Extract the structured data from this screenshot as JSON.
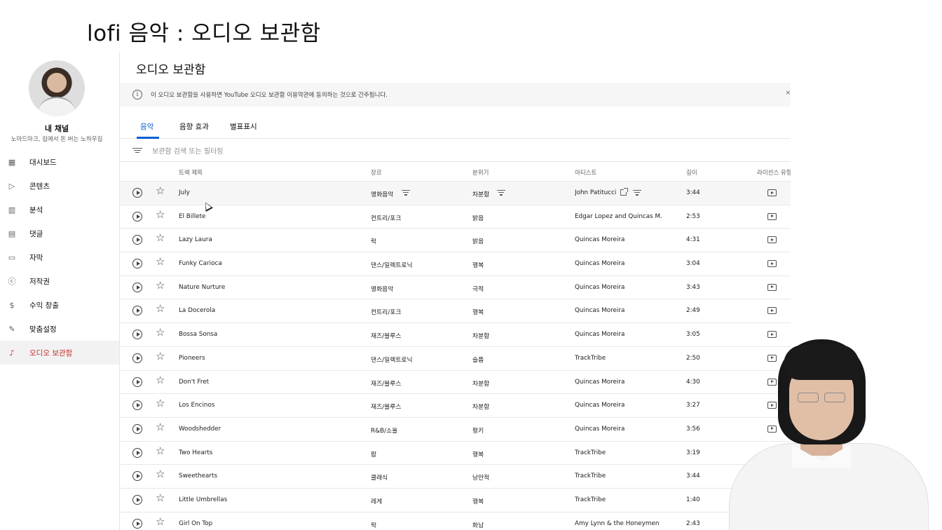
{
  "video_title": "lofi 음악 : 오디오 보관함",
  "sidebar": {
    "channel_name": "내 채널",
    "channel_handle": "노마드마크, 집에서 돈 버는 노하우집",
    "items": [
      {
        "label": "대시보드",
        "icon": "dashboard-icon"
      },
      {
        "label": "콘텐츠",
        "icon": "content-icon"
      },
      {
        "label": "분석",
        "icon": "analytics-icon"
      },
      {
        "label": "댓글",
        "icon": "comments-icon"
      },
      {
        "label": "자막",
        "icon": "subtitles-icon"
      },
      {
        "label": "저작권",
        "icon": "copyright-icon"
      },
      {
        "label": "수익 창출",
        "icon": "monetization-icon"
      },
      {
        "label": "맞춤설정",
        "icon": "customization-icon"
      },
      {
        "label": "오디오 보관함",
        "icon": "audio-library-icon"
      }
    ],
    "active_index": 8
  },
  "main": {
    "title": "오디오 보관함",
    "notice": "이 오디오 보관함을 사용하면 YouTube 오디오 보관함 이용약관에 동의하는 것으로 간주됩니다.",
    "tabs": [
      "음악",
      "음향 효과",
      "별표표시"
    ],
    "active_tab": 0,
    "filter_placeholder": "보관함 검색 또는 필터링",
    "columns": [
      "트랙 제목",
      "장르",
      "분위기",
      "아티스트",
      "길이",
      "라이선스 유형"
    ],
    "rows": [
      {
        "title": "July",
        "genre": "영화음악",
        "mood": "차분함",
        "artist": "John Patitucci",
        "length": "3:44"
      },
      {
        "title": "El Billete",
        "genre": "컨트리/포크",
        "mood": "밝음",
        "artist": "Edgar Lopez and Quincas M...",
        "length": "2:53"
      },
      {
        "title": "Lazy Laura",
        "genre": "락",
        "mood": "밝음",
        "artist": "Quincas Moreira",
        "length": "4:31"
      },
      {
        "title": "Funky Carioca",
        "genre": "댄스/일렉트로닉",
        "mood": "행복",
        "artist": "Quincas Moreira",
        "length": "3:04"
      },
      {
        "title": "Nature Nurture",
        "genre": "영화음악",
        "mood": "극적",
        "artist": "Quincas Moreira",
        "length": "3:43"
      },
      {
        "title": "La Docerola",
        "genre": "컨트리/포크",
        "mood": "행복",
        "artist": "Quincas Moreira",
        "length": "2:49"
      },
      {
        "title": "Bossa Sonsa",
        "genre": "재즈/블루스",
        "mood": "차분함",
        "artist": "Quincas Moreira",
        "length": "3:05"
      },
      {
        "title": "Pioneers",
        "genre": "댄스/일렉트로닉",
        "mood": "슬픔",
        "artist": "TrackTribe",
        "length": "2:50"
      },
      {
        "title": "Don't Fret",
        "genre": "재즈/블루스",
        "mood": "차분함",
        "artist": "Quincas Moreira",
        "length": "4:30"
      },
      {
        "title": "Los Encinos",
        "genre": "재즈/블루스",
        "mood": "차분함",
        "artist": "Quincas Moreira",
        "length": "3:27"
      },
      {
        "title": "Woodshedder",
        "genre": "R&B/소울",
        "mood": "펑키",
        "artist": "Quincas Moreira",
        "length": "3:56"
      },
      {
        "title": "Two Hearts",
        "genre": "팝",
        "mood": "행복",
        "artist": "TrackTribe",
        "length": "3:19"
      },
      {
        "title": "Sweethearts",
        "genre": "클래식",
        "mood": "낭만적",
        "artist": "TrackTribe",
        "length": "3:44"
      },
      {
        "title": "Little Umbrellas",
        "genre": "레게",
        "mood": "행복",
        "artist": "TrackTribe",
        "length": "1:40"
      },
      {
        "title": "Girl On Top",
        "genre": "락",
        "mood": "화남",
        "artist": "Amy Lynn & the Honeymen",
        "length": "2:43"
      }
    ]
  },
  "colors": {
    "accent": "#065fd4",
    "active_nav": "#c4302b",
    "notice_bg": "#f6f6f6"
  }
}
